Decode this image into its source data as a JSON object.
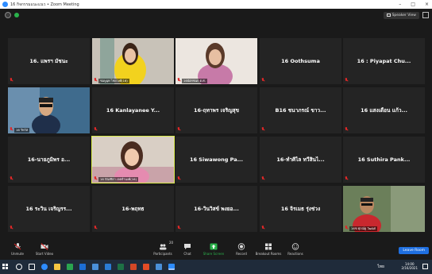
{
  "window": {
    "title": "16 กิจกรรมแนะแนว • Zoom Meeting",
    "controls": [
      "–",
      "□",
      "×"
    ]
  },
  "topbar": {
    "view_label": "Speaker View"
  },
  "tiles": [
    {
      "name": "16. แพรฯ มัชนะ",
      "label": "",
      "photo": false
    },
    {
      "name": "",
      "label": "ชมพูนุท ไชยวงศ์(16)",
      "photo": true,
      "photo_kind": "yellow-girl"
    },
    {
      "name": "",
      "label": "16ฉัตรชนก ต.ศ.",
      "photo": true,
      "photo_kind": "pink-girl"
    },
    {
      "name": "16 Oothsuma",
      "label": "",
      "photo": false
    },
    {
      "name": "16 : Piyapat Chu...",
      "label": "",
      "photo": false
    },
    {
      "name": "",
      "label": "16 วิทวัส",
      "photo": true,
      "photo_kind": "boy-sunglasses"
    },
    {
      "name": "16 Kanlayanee Y...",
      "label": "",
      "photo": false
    },
    {
      "name": "16-ฤทาพร เจริญสุข",
      "label": "",
      "photo": false
    },
    {
      "name": "B16 ชนาภรณ์ ขาว...",
      "label": "",
      "photo": false
    },
    {
      "name": "16 แสงเดือน แก้ว...",
      "label": "",
      "photo": false
    },
    {
      "name": "16-นายภูมิพร อ...",
      "label": "",
      "photo": false
    },
    {
      "name": "",
      "label": "16 ปัณฑิตา เจตจำนงค์(16)",
      "photo": true,
      "photo_kind": "smiling-girl",
      "active": true
    },
    {
      "name": "16 Siwawong Pa...",
      "label": "",
      "photo": false
    },
    {
      "name": "16-ทำศิไล ทวีสินไ...",
      "label": "",
      "photo": false
    },
    {
      "name": "16 Suthira Pank...",
      "label": "",
      "photo": false
    },
    {
      "name": "16 ระวิน เจริญรร...",
      "label": "",
      "photo": false
    },
    {
      "name": "16-พฤทธ",
      "label": "",
      "photo": false
    },
    {
      "name": "16-วินวิสข์ พงยอ...",
      "label": "",
      "photo": false
    },
    {
      "name": "16 จิรเมธ รุ่งช่วง",
      "label": "",
      "photo": false
    },
    {
      "name": "",
      "label": "16ช ศุภณ์ฐ วัฒนศ",
      "photo": true,
      "photo_kind": "boy-red"
    }
  ],
  "toolbar": {
    "unmute": "Unmute",
    "start_video": "Start Video",
    "participants": "Participants",
    "participants_count": "20",
    "chat": "Chat",
    "share_screen": "Share Screen",
    "record": "Record",
    "breakout": "Breakout Rooms",
    "reactions": "Reactions",
    "leave": "Leave Room"
  },
  "taskbar": {
    "time": "14:00",
    "date": "2/16/2021",
    "lang": "ไทย"
  },
  "colors": {
    "accent": "#1f6fe0",
    "muted_red": "#e02828",
    "active_border": "#d7e94a",
    "share_green": "#2ab24b"
  }
}
